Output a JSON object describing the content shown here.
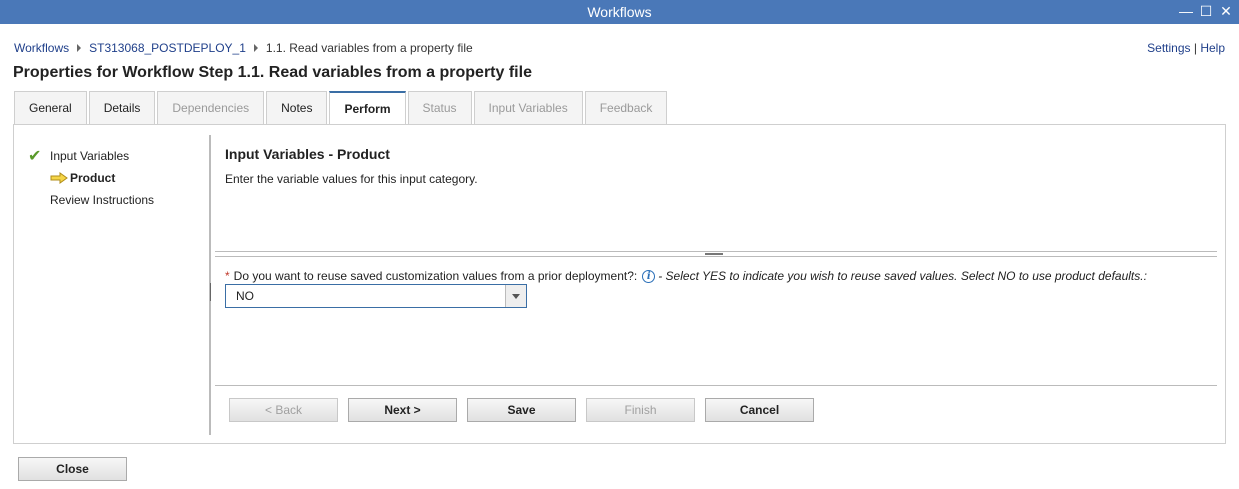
{
  "window": {
    "title": "Workflows",
    "controls": {
      "minimize": "—",
      "maximize": "☐",
      "close": "✕"
    }
  },
  "breadcrumb": {
    "items": [
      "Workflows",
      "ST313068_POSTDEPLOY_1"
    ],
    "current": "1.1. Read variables from a property file"
  },
  "toplinks": {
    "settings": "Settings",
    "separator": " | ",
    "help": "Help"
  },
  "page_title": "Properties for Workflow Step 1.1. Read variables from a property file",
  "tabs": [
    {
      "label": "General",
      "state": "enabled"
    },
    {
      "label": "Details",
      "state": "enabled"
    },
    {
      "label": "Dependencies",
      "state": "disabled"
    },
    {
      "label": "Notes",
      "state": "enabled"
    },
    {
      "label": "Perform",
      "state": "active"
    },
    {
      "label": "Status",
      "state": "disabled"
    },
    {
      "label": "Input Variables",
      "state": "disabled"
    },
    {
      "label": "Feedback",
      "state": "disabled"
    }
  ],
  "steps": {
    "input_variables": "Input Variables",
    "product": "Product",
    "review": "Review Instructions"
  },
  "content": {
    "heading": "Input Variables - Product",
    "description": "Enter the variable values for this input category.",
    "question": {
      "required_mark": "*",
      "label": "Do you want to reuse saved customization values from a prior deployment?:",
      "hint": "- Select YES to indicate you wish to reuse saved values. Select NO to use product defaults.:",
      "value": "NO"
    }
  },
  "buttons": {
    "back": "< Back",
    "next": "Next >",
    "save": "Save",
    "finish": "Finish",
    "cancel": "Cancel",
    "close": "Close"
  },
  "colors": {
    "titlebar": "#4a78b8",
    "link": "#1f3f8a",
    "active_tab_accent": "#3a6ea5",
    "required": "#c0392b",
    "check": "#5a9a2a"
  },
  "icons": {
    "completed_step": "check-icon",
    "current_step": "arrow-right-icon",
    "help": "info-icon"
  }
}
